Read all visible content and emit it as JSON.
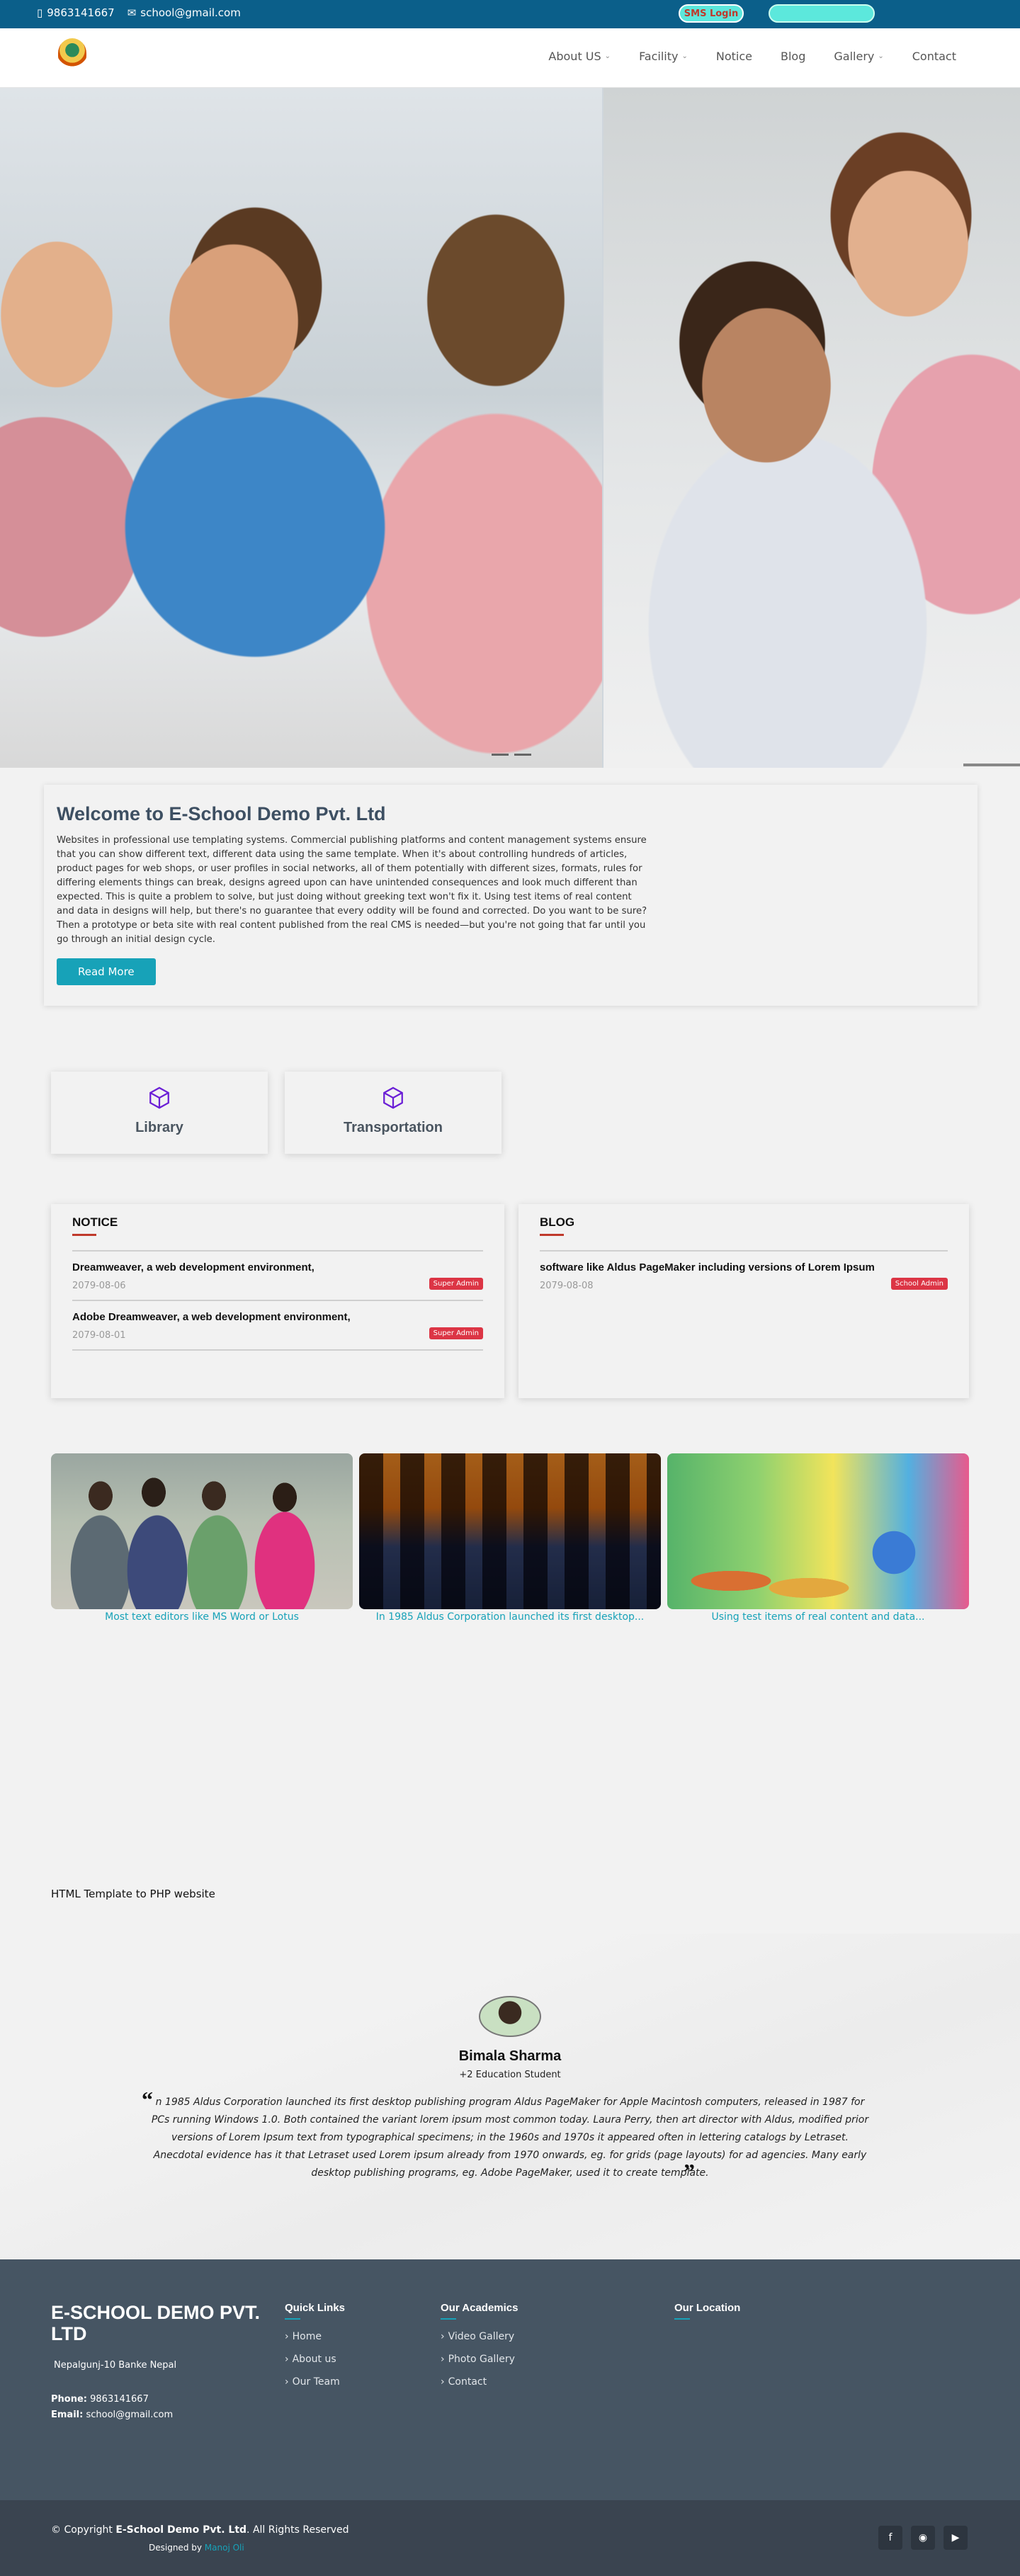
{
  "topbar": {
    "phone": "9863141667",
    "email": "school@gmail.com",
    "sms_login": "SMS Login"
  },
  "nav": {
    "items": [
      {
        "label": "About US",
        "dropdown": true
      },
      {
        "label": "Facility",
        "dropdown": true
      },
      {
        "label": "Notice",
        "dropdown": false
      },
      {
        "label": "Blog",
        "dropdown": false
      },
      {
        "label": "Gallery",
        "dropdown": true
      },
      {
        "label": "Contact",
        "dropdown": false
      }
    ]
  },
  "welcome": {
    "title": "Welcome to E-School Demo Pvt. Ltd",
    "body": "Websites in professional use templating systems. Commercial publishing platforms and content management systems ensure that you can show different text, different data using the same template. When it's about controlling hundreds of articles, product pages for web shops, or user profiles in social networks, all of them potentially with different sizes, formats, rules for differing elements things can break, designs agreed upon can have unintended consequences and look much different than expected. This is quite a problem to solve, but just doing without greeking text won't fix it. Using test items of real content and data in designs will help, but there's no guarantee that every oddity will be found and corrected. Do you want to be sure? Then a prototype or beta site with real content published from the real CMS is needed—but you're not going that far until you go through an initial design cycle.",
    "button": "Read More"
  },
  "features": [
    "Library",
    "Transportation"
  ],
  "notice": {
    "title": "NOTICE",
    "items": [
      {
        "title": "Dreamweaver, a web development environment,",
        "date": "2079-08-06",
        "badge": "Super Admin"
      },
      {
        "title": "Adobe Dreamweaver, a web development environment,",
        "date": "2079-08-01",
        "badge": "Super Admin"
      }
    ]
  },
  "blog": {
    "title": "BLOG",
    "items": [
      {
        "title": "software like Aldus PageMaker including versions of Lorem Ipsum",
        "date": "2079-08-08",
        "badge": "School Admin"
      }
    ]
  },
  "gallery": [
    {
      "caption": "Most text editors like MS Word or Lotus"
    },
    {
      "caption": "In 1985 Aldus Corporation launched its first desktop..."
    },
    {
      "caption": "Using test items of real content and data..."
    }
  ],
  "tagline": "HTML Template to PHP website",
  "testimonial": {
    "name": "Bimala Sharma",
    "role": "+2 Education Student",
    "quote": "n 1985 Aldus Corporation launched its first desktop publishing program Aldus PageMaker for Apple Macintosh computers, released in 1987 for PCs running Windows 1.0. Both contained the variant lorem ipsum most common today. Laura Perry, then art director with Aldus, modified prior versions of Lorem Ipsum text from typographical specimens; in the 1960s and 1970s it appeared often in lettering catalogs by Letraset. Anecdotal evidence has it that Letraset used Lorem ipsum already from 1970 onwards, eg. for grids (page layouts) for ad agencies. Many early desktop publishing programs, eg. Adobe PageMaker, used it to create template."
  },
  "footer": {
    "brand": "E-SCHOOL DEMO PVT. LTD",
    "address": "Nepalgunj-10 Banke Nepal",
    "phone_label": "Phone:",
    "phone": "9863141667",
    "email_label": "Email:",
    "email": "school@gmail.com",
    "quick_links": {
      "title": "Quick Links",
      "items": [
        "Home",
        "About us",
        "Our Team"
      ]
    },
    "academics": {
      "title": "Our Academics",
      "items": [
        "Video Gallery",
        "Photo Gallery",
        "Contact"
      ]
    },
    "location": {
      "title": "Our Location"
    }
  },
  "bottom": {
    "copy_prefix": "© Copyright",
    "company": "E-School Demo Pvt. Ltd",
    "copy_suffix": ". All Rights Reserved",
    "designed_prefix": "Designed by",
    "designer": "Manoj Oli",
    "social": [
      "facebook-icon",
      "instagram-icon",
      "youtube-icon"
    ]
  },
  "colors": {
    "topbar": "#0b5f8a",
    "accent": "#17a2b8",
    "badge": "#dc3545",
    "footer": "#465563"
  }
}
